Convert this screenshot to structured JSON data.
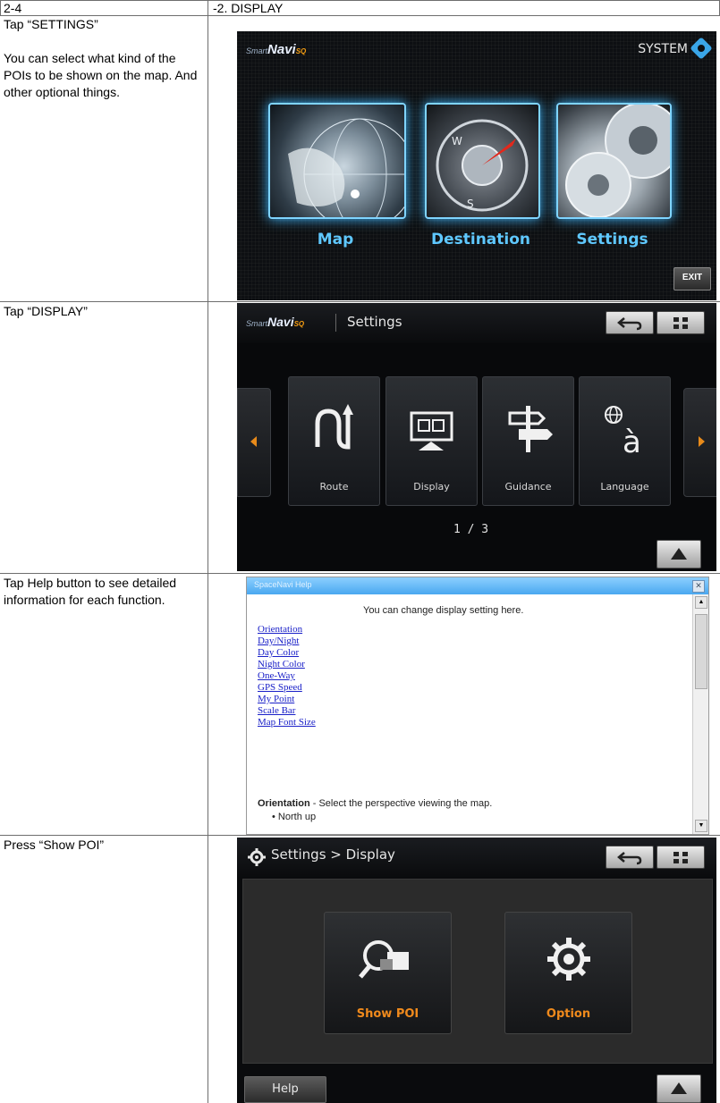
{
  "header": {
    "section_number": "2-4",
    "section_title": "-2. DISPLAY"
  },
  "steps": [
    {
      "instruction": "Tap “SETTINGS”",
      "description": "You can select what kind of the POIs to be shown on the map. And other optional things."
    },
    {
      "instruction": "Tap “DISPLAY”"
    },
    {
      "instruction": "Tap Help button to see detailed information for each function."
    },
    {
      "instruction": "Press “Show POI”"
    }
  ],
  "screen_main": {
    "logo": "Navi",
    "logo_prefix": "Smart",
    "logo_suffix": "SQ",
    "system_label": "SYSTEM",
    "tiles": [
      "Map",
      "Destination",
      "Settings"
    ],
    "exit_label": "EXIT",
    "accent_color": "#5fc8ff"
  },
  "screen_settings": {
    "title": "Settings",
    "back_icon": "back-arrow-icon",
    "menu_icon": "grid-icon",
    "cards": [
      "Route",
      "Display",
      "Guidance",
      "Language"
    ],
    "pager": "1 / 3"
  },
  "screen_help": {
    "title": "SpaceNavi Help",
    "intro": "You can change display setting here.",
    "links": [
      "Orientation",
      "Day/Night",
      "Day Color",
      "Night Color",
      "One-Way",
      "GPS Speed",
      "My Point",
      "Scale Bar",
      "Map Font Size"
    ],
    "section_heading": "Orientation",
    "section_text": " - Select the perspective viewing the map.",
    "bullet": "North up"
  },
  "screen_display": {
    "breadcrumb": "Settings > Display",
    "buttons": [
      "Show POI",
      "Option"
    ],
    "help_label": "Help",
    "accent_color": "#f08a1c"
  }
}
